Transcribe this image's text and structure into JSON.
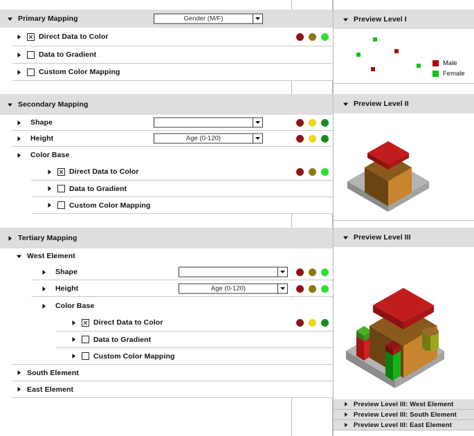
{
  "tree": {
    "sections": [
      {
        "id": "primary",
        "label": "Primary Mapping",
        "expanded": true,
        "dropdown": {
          "value": "Gender (M/F)"
        },
        "rows": [
          {
            "label": "Direct Data to Color",
            "checked": true,
            "dots": [
              "#8f1515",
              "#8a7a10",
              "#2fe02f"
            ]
          },
          {
            "label": "Data to Gradient",
            "checked": false,
            "dots": []
          },
          {
            "label": "Custom Color Mapping",
            "checked": false,
            "dots": []
          }
        ]
      },
      {
        "id": "secondary",
        "label": "Secondary Mapping",
        "expanded": true,
        "rows": [
          {
            "label": "Shape",
            "dropdown": {
              "value": ""
            },
            "dots": [
              "#8f1515",
              "#f2d718",
              "#1d8a1d"
            ]
          },
          {
            "label": "Height",
            "dropdown": {
              "value": "Age (0-120)"
            },
            "dots": [
              "#8f1515",
              "#f2d718",
              "#1d8a1d"
            ]
          },
          {
            "label": "Color Base",
            "dots": []
          },
          {
            "label": "Direct Data to Color",
            "checked": true,
            "dots": [
              "#8f1515",
              "#8a7a10",
              "#2fe02f"
            ]
          },
          {
            "label": "Data to Gradient",
            "checked": false,
            "dots": []
          },
          {
            "label": "Custom Color Mapping",
            "checked": false,
            "dots": []
          }
        ]
      },
      {
        "id": "tertiary",
        "label": "Tertiary Mapping",
        "expanded": false,
        "rows": [
          {
            "label": "West Element",
            "expanded": true,
            "dots": []
          },
          {
            "label": "Shape",
            "dropdown": {
              "value": ""
            },
            "dots": [
              "#8f1515",
              "#8a7a10",
              "#2fe02f"
            ]
          },
          {
            "label": "Height",
            "dropdown": {
              "value": "Age (0-120)"
            },
            "dots": [
              "#8f1515",
              "#8a7a10",
              "#2fe02f"
            ]
          },
          {
            "label": "Color Base",
            "dots": []
          },
          {
            "label": "Direct Data to Color",
            "checked": true,
            "dots": [
              "#8f1515",
              "#f2d718",
              "#1d8a1d"
            ]
          },
          {
            "label": "Data to Gradient",
            "checked": false,
            "dots": []
          },
          {
            "label": "Custom Color Mapping",
            "checked": false,
            "dots": []
          },
          {
            "label": "South Element",
            "dots": []
          },
          {
            "label": "East Element",
            "dots": []
          }
        ]
      }
    ]
  },
  "preview": {
    "level1": {
      "title": "Preview Level I",
      "expanded": true,
      "chart_data": {
        "type": "scatter",
        "title": "Preview Level I",
        "xlabel": "",
        "ylabel": "",
        "grid": false,
        "legend_position": "right",
        "series": [
          {
            "name": "Male",
            "color": "#a50f0f",
            "points": [
              [
                0.55,
                0.52
              ],
              [
                0.29,
                0.16
              ]
            ]
          },
          {
            "name": "Female",
            "color": "#12c212",
            "points": [
              [
                0.46,
                0.82
              ],
              [
                0.2,
                0.6
              ],
              [
                0.73,
                0.36
              ]
            ]
          }
        ]
      },
      "legend": [
        {
          "label": "Male",
          "color": "#a50f0f"
        },
        {
          "label": "Female",
          "color": "#12c212"
        }
      ]
    },
    "level2": {
      "title": "Preview Level II",
      "expanded": true,
      "scene": {
        "base_color": "#9a9a9a",
        "body_color": "#c07c2a",
        "roof_color": "#c21d1d"
      }
    },
    "level3": {
      "title": "Preview Level III",
      "expanded": true,
      "scene": {
        "base_color": "#9a9a9a",
        "body_color": "#c07c2a",
        "roof_color": "#c21d1d",
        "west_color": "#d22020",
        "west_cap_color": "#4caf2a",
        "south_color": "#18b318",
        "south_cap_color": "#8f1515",
        "east_color": "#9aa81e"
      },
      "sub_previews": [
        {
          "label": "Preview Level III: West Element"
        },
        {
          "label": "Preview Level III: South Element"
        },
        {
          "label": "Preview Level III: East Element"
        }
      ]
    }
  }
}
